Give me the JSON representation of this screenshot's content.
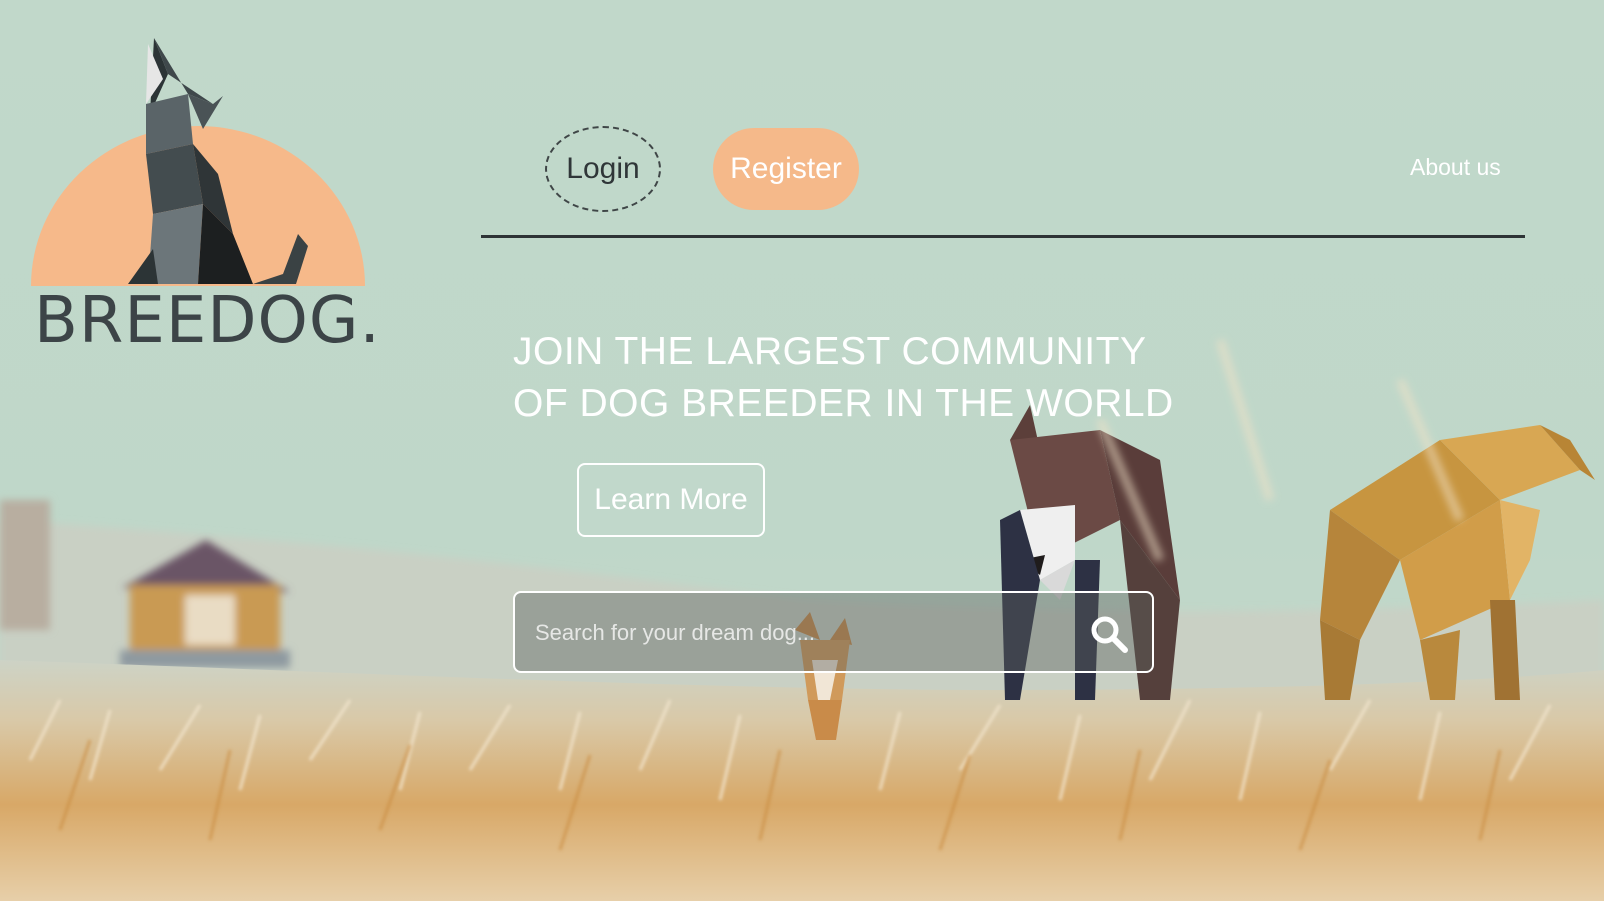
{
  "brand": {
    "name": "BREEDOG.",
    "logo_icon": "howling-wolf-icon"
  },
  "nav": {
    "login_label": "Login",
    "register_label": "Register",
    "about_label": "About us"
  },
  "hero": {
    "title_line1": "JOIN THE LARGEST COMMUNITY",
    "title_line2": "OF DOG BREEDER IN THE WORLD",
    "cta_label": "Learn More"
  },
  "search": {
    "placeholder": "Search for your dream dog...",
    "value": "",
    "icon": "search-icon"
  },
  "colors": {
    "background": "#c0d8ca",
    "accent": "#f5b98a",
    "text_dark": "#3c4447",
    "text_light": "#ffffff"
  }
}
